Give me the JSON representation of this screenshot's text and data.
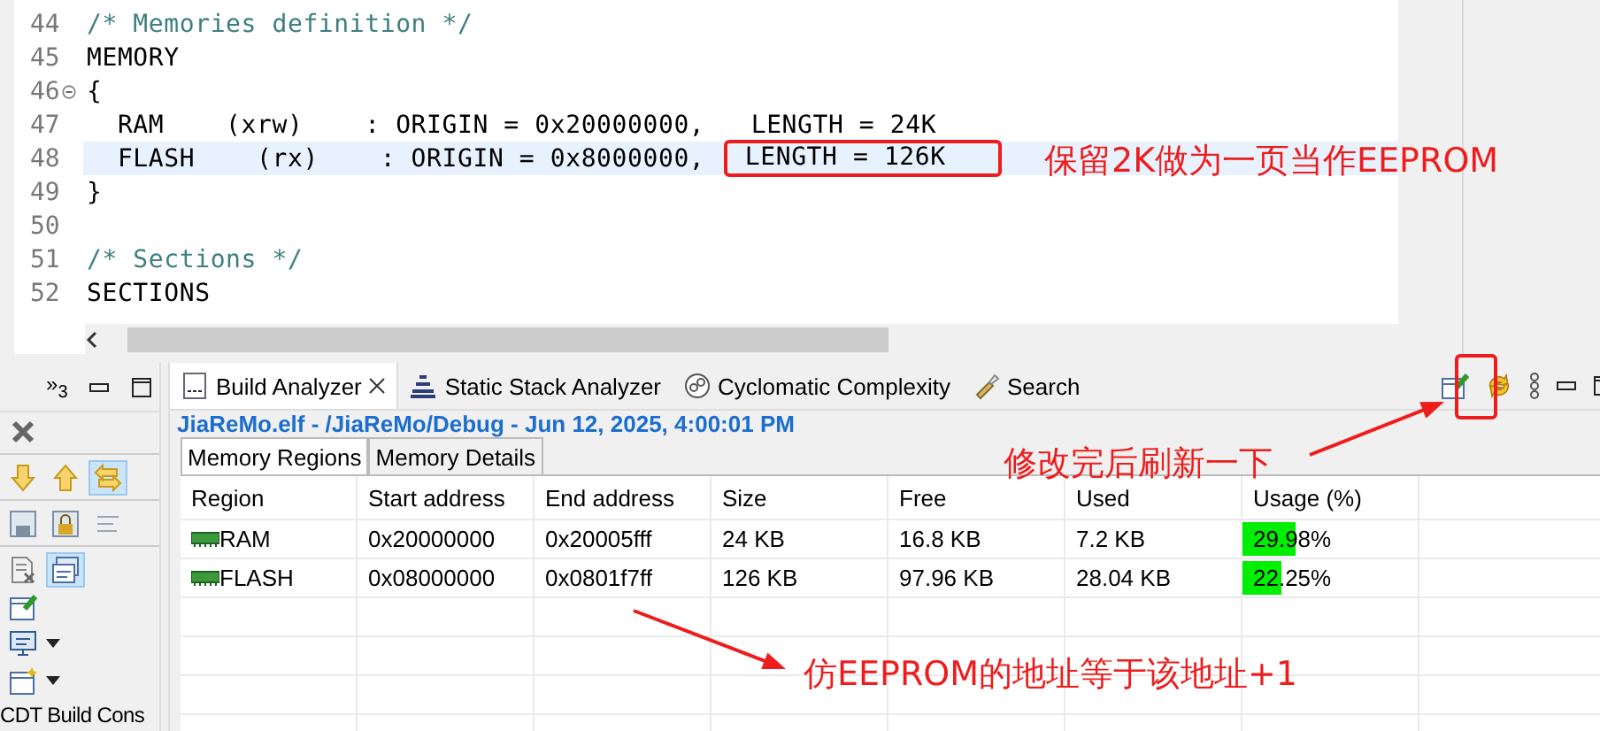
{
  "editor": {
    "lines": [
      {
        "number": "44",
        "text": "/* Memories definition */",
        "kind": "comment",
        "highlighted": false
      },
      {
        "number": "45",
        "text": "MEMORY",
        "kind": "code",
        "highlighted": false
      },
      {
        "number": "46",
        "text": "{",
        "kind": "code",
        "highlighted": false,
        "foldable": true
      },
      {
        "number": "47",
        "text": "  RAM    (xrw)    : ORIGIN = 0x20000000,   LENGTH = 24K",
        "kind": "code",
        "highlighted": false
      },
      {
        "number": "48",
        "text": "  FLASH    (rx)    : ORIGIN = 0x8000000, ",
        "boxed_text": "LENGTH = 126K",
        "kind": "code",
        "highlighted": true
      },
      {
        "number": "49",
        "text": "}",
        "kind": "code",
        "highlighted": false
      },
      {
        "number": "50",
        "highlighted": false
      },
      {
        "number": "51",
        "text": "/* Sections */",
        "kind": "comment",
        "highlighted": false
      },
      {
        "number": "52",
        "text": "SECTIONS",
        "kind": "code",
        "highlighted": false
      }
    ]
  },
  "side_panel": {
    "overflow": "»",
    "overflow_count": "3",
    "buttons": [
      {
        "kind": "stop",
        "pressed": false
      },
      {
        "kind": "down",
        "pressed": false
      },
      {
        "kind": "up",
        "pressed": false
      },
      {
        "kind": "link",
        "pressed": true
      },
      {
        "kind": "save",
        "pressed": false
      },
      {
        "kind": "lock",
        "pressed": false
      },
      {
        "kind": "lines",
        "pressed": false
      },
      {
        "kind": "clear",
        "pressed": false
      },
      {
        "kind": "display",
        "pressed": true
      },
      {
        "kind": "pin",
        "pressed": false
      },
      {
        "kind": "monitor",
        "pressed": false
      },
      {
        "kind": "new",
        "pressed": false
      }
    ],
    "view_label": "CDT Build Cons"
  },
  "analyzer": {
    "tabs": [
      {
        "label": "Build Analyzer",
        "kind": "build",
        "selected": true,
        "closable": true
      },
      {
        "label": "Static Stack Analyzer",
        "kind": "stack",
        "selected": false
      },
      {
        "label": "Cyclomatic Complexity",
        "kind": "cyclomatic",
        "selected": false
      },
      {
        "label": "Search",
        "kind": "search",
        "selected": false
      }
    ],
    "title": "JiaReMo.elf - /JiaReMo/Debug - Jun 12, 2025, 4:00:01 PM",
    "subtabs": [
      {
        "label": "Memory Regions",
        "selected": true
      },
      {
        "label": "Memory Details",
        "selected": false
      }
    ],
    "table": {
      "columns": [
        "Region",
        "Start address",
        "End address",
        "Size",
        "Free",
        "Used",
        "Usage (%)"
      ],
      "rows": [
        {
          "region": "RAM",
          "start": "0x20000000",
          "end": "0x20005fff",
          "size": "24 KB",
          "free": "16.8 KB",
          "used": "7.2 KB",
          "usage": "29.98%",
          "level": 0.2998
        },
        {
          "region": "FLASH",
          "start": "0x08000000",
          "end": "0x0801f7ff",
          "size": "126 KB",
          "free": "97.96 KB",
          "used": "28.04 KB",
          "usage": "22.25%",
          "level": 0.2225
        }
      ]
    }
  },
  "annotations": [
    {
      "text": "保留2K做为一页当作EEPROM",
      "kind": "length-note"
    },
    {
      "text": "修改完后刷新一下",
      "kind": "refresh-note"
    },
    {
      "text": "仿EEPROM的地址等于该地址+1",
      "kind": "address-note"
    }
  ]
}
